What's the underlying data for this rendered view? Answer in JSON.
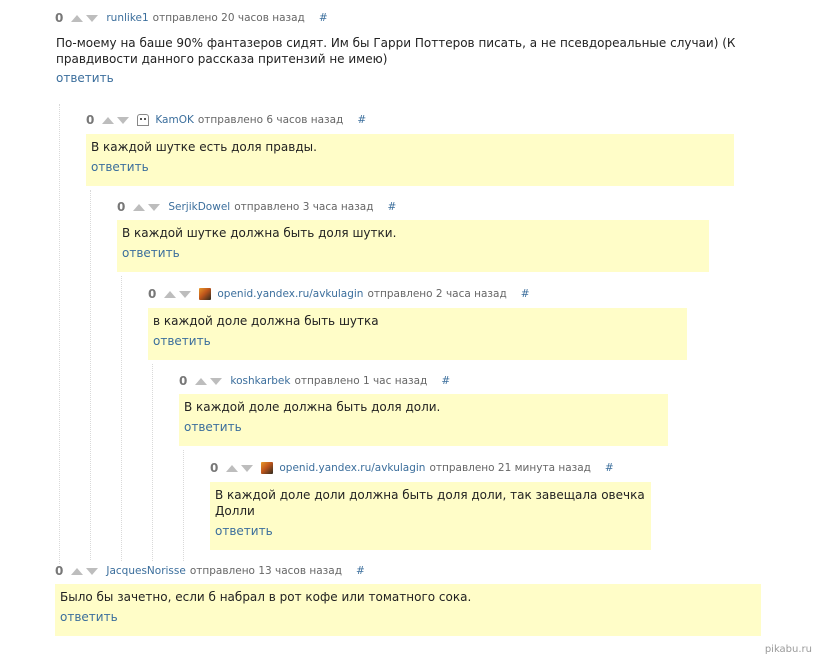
{
  "comments": [
    {
      "score": "0",
      "user": "runlike1",
      "sent": "отправлено 20 часов назад",
      "hash": "#",
      "avatar": "none",
      "text": "По-моему на баше 90% фантазеров сидят. Им бы Гарри Поттеров писать, а не псевдореальные случаи) (К правдивости данного рассказа притензий не имею)",
      "reply": "ответить"
    },
    {
      "score": "0",
      "user": "KamOK",
      "sent": "отправлено 6 часов назад",
      "hash": "#",
      "avatar": "ghost-avatar",
      "text": "В каждой шутке есть доля правды.",
      "reply": "ответить"
    },
    {
      "score": "0",
      "user": "SerjikDowel",
      "sent": "отправлено 3 часа назад",
      "hash": "#",
      "avatar": "none",
      "text": "В каждой шутке должна быть доля шутки.",
      "reply": "ответить"
    },
    {
      "score": "0",
      "user": "openid.yandex.ru/avkulagin",
      "sent": "отправлено 2 часа назад",
      "hash": "#",
      "avatar": "photo-avatar",
      "text": "в каждой доле должна быть шутка",
      "reply": "ответить"
    },
    {
      "score": "0",
      "user": "koshkarbek",
      "sent": "отправлено 1 час назад",
      "hash": "#",
      "avatar": "none",
      "text": "В каждой доле должна быть доля доли.",
      "reply": "ответить"
    },
    {
      "score": "0",
      "user": "openid.yandex.ru/avkulagin",
      "sent": "отправлено 21 минута назад",
      "hash": "#",
      "avatar": "photo-avatar",
      "text": "В каждой доле доли должна быть доля доли, так завещала овечка Долли",
      "reply": "ответить"
    },
    {
      "score": "0",
      "user": "JacquesNorisse",
      "sent": "отправлено 13 часов назад",
      "hash": "#",
      "avatar": "none",
      "text": "Было бы зачетно, если б набрал в рот кофе или томатного сока.",
      "reply": "ответить"
    }
  ],
  "watermark": "pikabu.ru",
  "colors": {
    "highlight": "#fffdc8",
    "link": "#3b6e9c",
    "meta": "#666666",
    "arrow": "#bdbdbd"
  }
}
